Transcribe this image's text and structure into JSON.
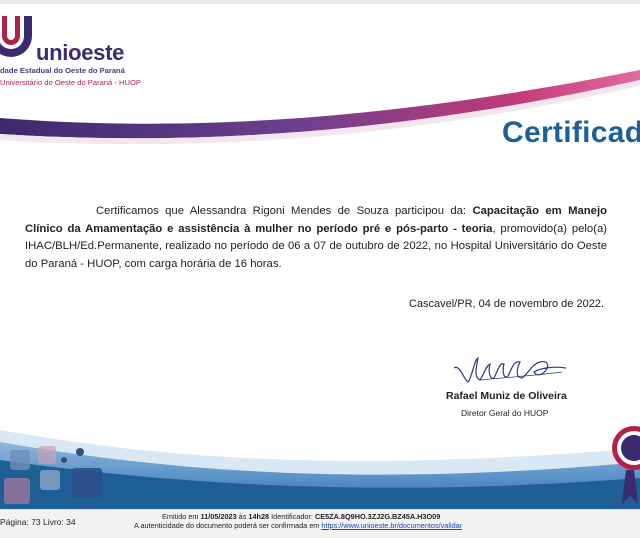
{
  "logo": {
    "name": "unioeste",
    "subtitle1": "dade Estadual do Oeste do Paraná",
    "subtitle2": "Universitário do Oeste do Paraná - HUOP"
  },
  "certificate": {
    "title": "Certificad",
    "body_part1": "Certificamos que Alessandra Rigoni Mendes de Souza participou da: ",
    "course": "Capacitação em Manejo Clínico da Amamentação e assistência à mulher no período pré e pós-parto - teoria",
    "body_part2": ", promovido(a) pelo(a) IHAC/BLH/Ed.Permanente, realizado no período de 06 a 07 de outubro de 2022, no Hospital Universitário do Oeste do Paraná - HUOP, com carga horária de 16 horas.",
    "place_date": "Cascavel/PR, 04 de novembro de 2022."
  },
  "signatory": {
    "name": "Rafael Muniz de Oliveira",
    "role": "Diretor Geral do HUOP"
  },
  "footer": {
    "page_info": "Página: 73 Livro: 34",
    "emitted_prefix": "Emitido em ",
    "emitted_date": "11/05/2023",
    "emitted_at": " às ",
    "emitted_time": "14h28",
    "identifier_label": " Identificador: ",
    "identifier": "CE5ZA.8Q9HO.3ZJ2G.BZ45A.H3O09",
    "auth_text": "A autenticidade do documento poderá ser confirmada em ",
    "auth_link": "https://www.unioeste.br/documentos/validar"
  },
  "colors": {
    "primary_blue": "#1e5f96",
    "purple": "#3b2a6e",
    "magenta": "#b0224a"
  }
}
